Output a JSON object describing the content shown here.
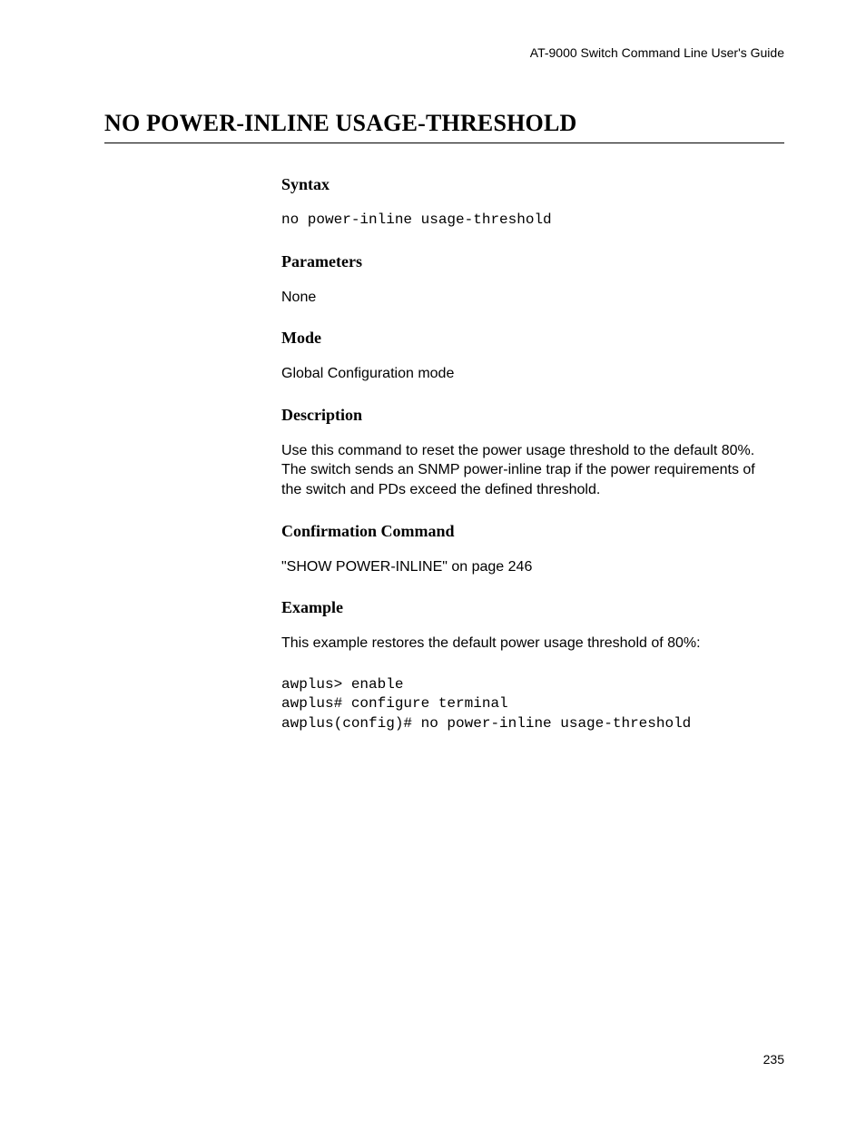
{
  "header": {
    "guide_title": "AT-9000 Switch Command Line User's Guide"
  },
  "title": "NO POWER-INLINE USAGE-THRESHOLD",
  "sections": {
    "syntax": {
      "heading": "Syntax",
      "code": "no power-inline usage-threshold"
    },
    "parameters": {
      "heading": "Parameters",
      "text": "None"
    },
    "mode": {
      "heading": "Mode",
      "text": "Global Configuration mode"
    },
    "description": {
      "heading": "Description",
      "text": "Use this command to reset the power usage threshold to the default 80%. The switch sends an SNMP power-inline trap if the power requirements of the switch and PDs exceed the defined threshold."
    },
    "confirmation": {
      "heading": "Confirmation Command",
      "text": "\"SHOW POWER-INLINE\" on page 246"
    },
    "example": {
      "heading": "Example",
      "intro": "This example restores the default power usage threshold of 80%:",
      "code": "awplus> enable\nawplus# configure terminal\nawplus(config)# no power-inline usage-threshold"
    }
  },
  "page_number": "235"
}
